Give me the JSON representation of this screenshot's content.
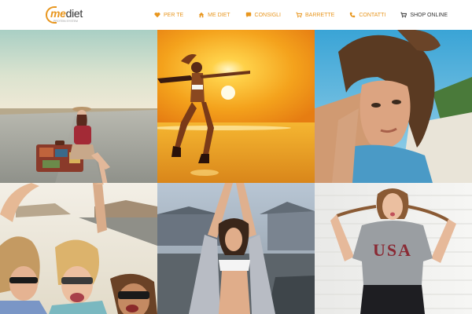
{
  "logo": {
    "brand_me": "me",
    "brand_rest": "diet",
    "tagline": "PROTEIN SYSTEM"
  },
  "nav": {
    "items": [
      {
        "label": "PER TE",
        "icon": "heart-icon"
      },
      {
        "label": "ME DIET",
        "icon": "home-icon"
      },
      {
        "label": "CONSIGLI",
        "icon": "chat-bubble-icon"
      },
      {
        "label": "BARRETTE",
        "icon": "cart-icon"
      },
      {
        "label": "CONTATTI",
        "icon": "phone-icon"
      },
      {
        "label": "SHOP ONLINE",
        "icon": "cart-icon"
      }
    ]
  },
  "colors": {
    "accent": "#e8961e",
    "text_dark": "#333333"
  },
  "photos": [
    {
      "subject": "woman-with-suitcase-on-road"
    },
    {
      "subject": "woman-jumping-at-sunset-beach"
    },
    {
      "subject": "woman-portrait-at-beach"
    },
    {
      "subject": "friends-in-convertible"
    },
    {
      "subject": "woman-stretching-arms-up"
    },
    {
      "subject": "woman-in-usa-tshirt"
    }
  ],
  "shirt_text": "USA"
}
